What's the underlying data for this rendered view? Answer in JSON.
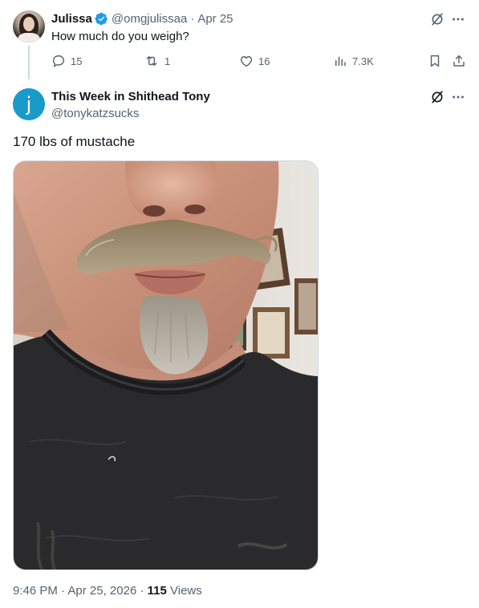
{
  "reply_context": {
    "author_name": "Julissa",
    "author_handle": "@omgjulissaa",
    "separator": "·",
    "date": "Apr 25",
    "text": "How much do you weigh?",
    "stats": {
      "replies": "15",
      "reposts": "1",
      "likes": "16",
      "views": "7.3K"
    }
  },
  "tweet": {
    "author_name": "This Week in Shithead Tony",
    "author_handle": "@tonykatzsucks",
    "avatar_letter": "j",
    "text": "170 lbs of mustache",
    "time": "9:46 PM",
    "separator": "·",
    "date": "Apr 25, 2026",
    "views_count": "115",
    "views_label": "Views"
  },
  "icons": {
    "verified": "verified-badge-icon",
    "grok": "grok-icon",
    "more": "more-icon",
    "reply": "reply-icon",
    "repost": "repost-icon",
    "like": "like-icon",
    "views": "views-icon",
    "bookmark": "bookmark-icon",
    "share": "share-icon"
  },
  "colors": {
    "primary_text": "#0f1419",
    "secondary_text": "#536471",
    "verified_blue": "#1d9bf0",
    "avatar_j": "#1a9ac9"
  }
}
